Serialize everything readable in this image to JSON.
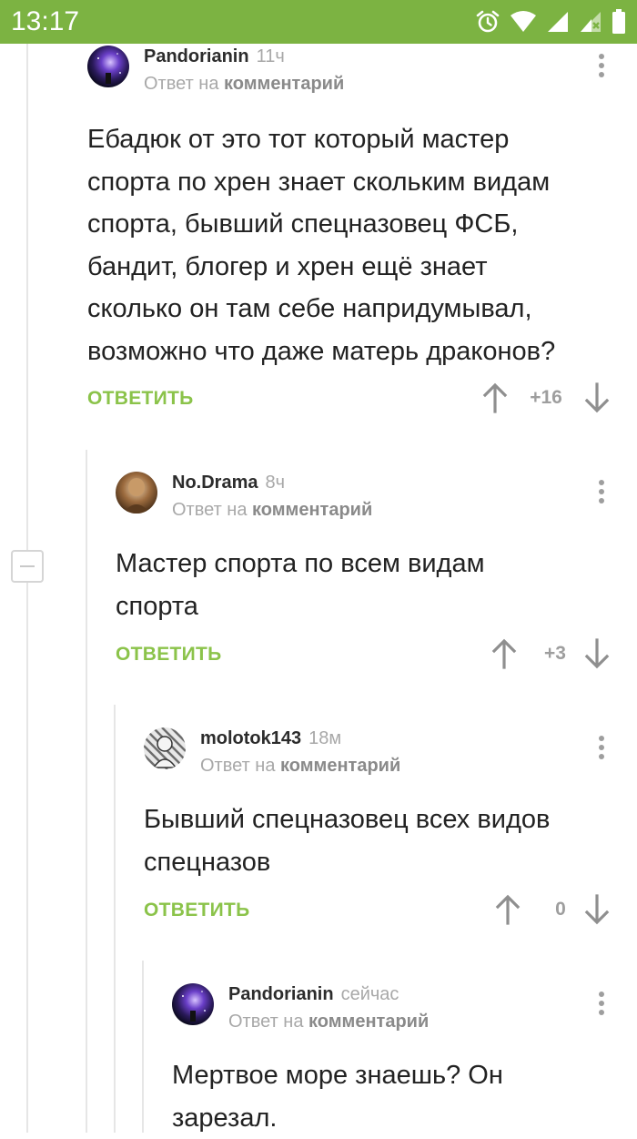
{
  "status_bar": {
    "time": "13:17"
  },
  "comments": [
    {
      "author": "Pandorianin",
      "time": "11ч",
      "reply_prefix": "Ответ на",
      "reply_target": "комментарий",
      "text": "Ебадюк от это тот который мастер\nспорта по хрен знает скольким видам\nспорта, бывший спецназовец ФСБ,\nбандит, блогер и хрен ещё знает\nсколько он там себе напридумывал,\nвозможно что даже матерь драконов?",
      "reply_label": "ОТВЕТИТЬ",
      "rating": "+16"
    },
    {
      "author": "No.Drama",
      "time": "8ч",
      "reply_prefix": "Ответ на",
      "reply_target": "комментарий",
      "text": "Мастер спорта по всем видам\nспорта",
      "reply_label": "ОТВЕТИТЬ",
      "rating": "+3"
    },
    {
      "author": "molotok143",
      "time": "18м",
      "reply_prefix": "Ответ на",
      "reply_target": "комментарий",
      "text": "Бывший спецназовец всех видов\nспецназов",
      "reply_label": "ОТВЕТИТЬ",
      "rating": "0"
    },
    {
      "author": "Pandorianin",
      "time": "сейчас",
      "reply_prefix": "Ответ на",
      "reply_target": "комментарий",
      "text": "Мертвое море знаешь? Он\nзарезал."
    }
  ],
  "colors": {
    "accent": "#8bc34a",
    "status_bar": "#7cb342",
    "muted": "#a8a8a8"
  },
  "icons": [
    "alarm-icon",
    "wifi-icon",
    "signal-icon",
    "more-vert-icon",
    "arrow-up-icon",
    "arrow-down-icon",
    "collapse-icon"
  ]
}
